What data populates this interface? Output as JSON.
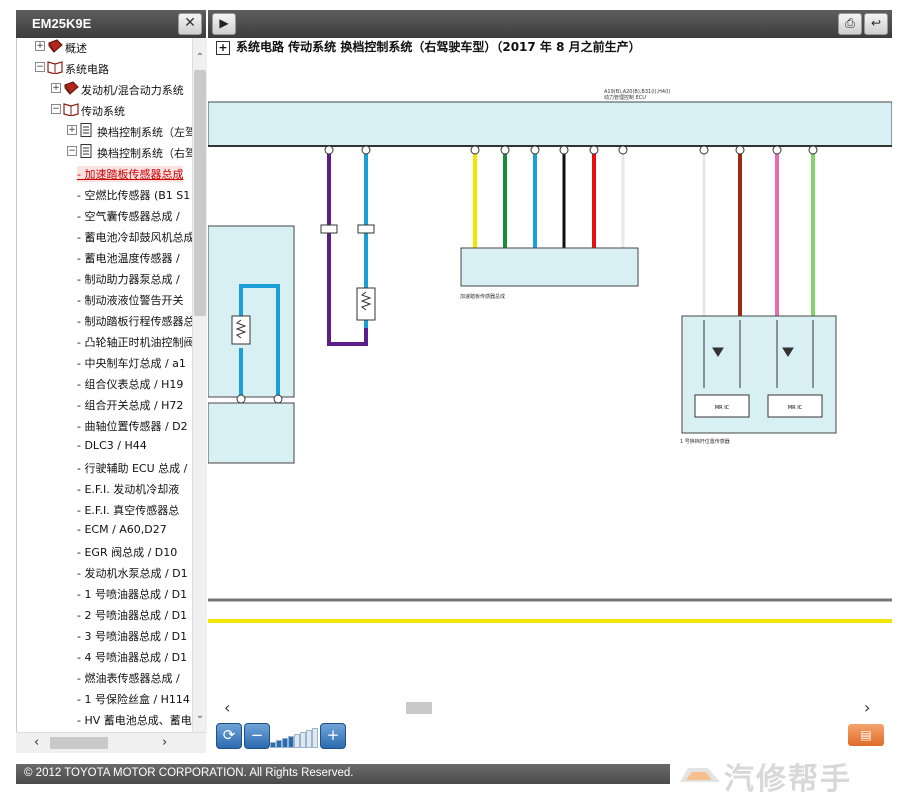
{
  "left_panel": {
    "title": "EM25K9E",
    "close_symbol": "✕"
  },
  "tree": {
    "items": [
      {
        "level": 1,
        "toggle": "+",
        "icon": "book-closed",
        "label": "概述"
      },
      {
        "level": 1,
        "toggle": "−",
        "icon": "book-open",
        "label": "系统电路"
      },
      {
        "level": 2,
        "toggle": "+",
        "icon": "book-closed",
        "label": "发动机/混合动力系统"
      },
      {
        "level": 2,
        "toggle": "−",
        "icon": "book-open",
        "label": "传动系统"
      },
      {
        "level": 3,
        "toggle": "+",
        "icon": "page",
        "label": "换档控制系统（左驾"
      },
      {
        "level": 3,
        "toggle": "−",
        "icon": "page",
        "label": "换档控制系统（右驾"
      },
      {
        "level": 4,
        "toggle": "",
        "icon": "",
        "label": "- 加速踏板传感器总成",
        "selected": true
      },
      {
        "level": 4,
        "toggle": "",
        "icon": "",
        "label": "- 空燃比传感器 (B1 S1"
      },
      {
        "level": 4,
        "toggle": "",
        "icon": "",
        "label": "- 空气囊传感器总成 /"
      },
      {
        "level": 4,
        "toggle": "",
        "icon": "",
        "label": "- 蓄电池冷却鼓风机总成"
      },
      {
        "level": 4,
        "toggle": "",
        "icon": "",
        "label": "- 蓄电池温度传感器 /"
      },
      {
        "level": 4,
        "toggle": "",
        "icon": "",
        "label": "- 制动助力器泵总成 /"
      },
      {
        "level": 4,
        "toggle": "",
        "icon": "",
        "label": "- 制动液液位警告开关"
      },
      {
        "level": 4,
        "toggle": "",
        "icon": "",
        "label": "- 制动踏板行程传感器总"
      },
      {
        "level": 4,
        "toggle": "",
        "icon": "",
        "label": "- 凸轮轴正时机油控制阀"
      },
      {
        "level": 4,
        "toggle": "",
        "icon": "",
        "label": "- 中央制车灯总成 / a1"
      },
      {
        "level": 4,
        "toggle": "",
        "icon": "",
        "label": "- 组合仪表总成 / H19"
      },
      {
        "level": 4,
        "toggle": "",
        "icon": "",
        "label": "- 组合开关总成 / H72"
      },
      {
        "level": 4,
        "toggle": "",
        "icon": "",
        "label": "- 曲轴位置传感器 / D2"
      },
      {
        "level": 4,
        "toggle": "",
        "icon": "",
        "label": "- DLC3 / H44"
      },
      {
        "level": 4,
        "toggle": "",
        "icon": "",
        "label": "- 行驶辅助 ECU 总成 /"
      },
      {
        "level": 4,
        "toggle": "",
        "icon": "",
        "label": "- E.F.I. 发动机冷却液"
      },
      {
        "level": 4,
        "toggle": "",
        "icon": "",
        "label": "- E.F.I. 真空传感器总"
      },
      {
        "level": 4,
        "toggle": "",
        "icon": "",
        "label": "- ECM / A60,D27"
      },
      {
        "level": 4,
        "toggle": "",
        "icon": "",
        "label": "- EGR 阀总成 / D10"
      },
      {
        "level": 4,
        "toggle": "",
        "icon": "",
        "label": "- 发动机水泵总成 / D1"
      },
      {
        "level": 4,
        "toggle": "",
        "icon": "",
        "label": "- 1 号喷油器总成 / D1"
      },
      {
        "level": 4,
        "toggle": "",
        "icon": "",
        "label": "- 2 号喷油器总成 / D1"
      },
      {
        "level": 4,
        "toggle": "",
        "icon": "",
        "label": "- 3 号喷油器总成 / D1"
      },
      {
        "level": 4,
        "toggle": "",
        "icon": "",
        "label": "- 4 号喷油器总成 / D1"
      },
      {
        "level": 4,
        "toggle": "",
        "icon": "",
        "label": "- 燃油表传感器总成 /"
      },
      {
        "level": 4,
        "toggle": "",
        "icon": "",
        "label": "- 1 号保险丝盒 / H114"
      },
      {
        "level": 4,
        "toggle": "",
        "icon": "",
        "label": "- HV 蓄电池总成、蓄电"
      }
    ]
  },
  "document": {
    "title_box": "+",
    "title": "系统电路  传动系统  换档控制系统（右驾驶车型）（2017 年 8 月之前生产）"
  },
  "diagram": {
    "top_label": "A19(B),A20(B),B31(I),H4(I)",
    "top_label2": "动力管理控制 ECU",
    "wire_colors": {
      "purple": "#5b1f8c",
      "blue": "#1a9fd6",
      "yellow": "#f2e600",
      "green": "#1a8c3a",
      "black": "#111111",
      "red": "#e60f12",
      "white": "#e8e8e8",
      "brown": "#9b2a12",
      "pink": "#e96bb0",
      "lightgreen": "#86d36b",
      "panel": "#d8f0f4"
    },
    "bottom_connector_label": "加速踏板传感器总成",
    "right_component_label": "1 号换档杆位置传感器",
    "ic_labels": [
      "MR IC",
      "MR IC"
    ]
  },
  "toolbar": {
    "zoom_level": 4,
    "zoom_max": 8
  },
  "footer": {
    "copyright": "© 2012 TOYOTA MOTOR CORPORATION. All Rights Reserved."
  },
  "watermark": {
    "text": "汽修帮手"
  }
}
